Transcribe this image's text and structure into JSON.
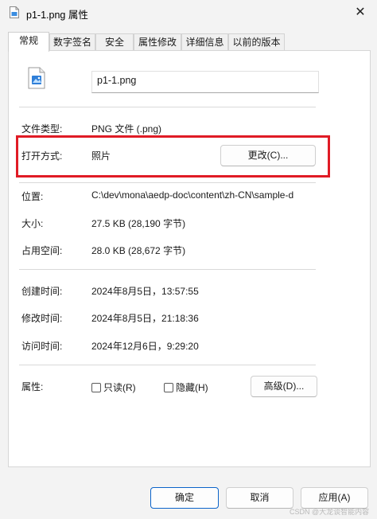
{
  "window": {
    "title": "p1-1.png 属性",
    "close_glyph": "✕"
  },
  "tabs": [
    {
      "label": "常规",
      "active": true
    },
    {
      "label": "数字签名"
    },
    {
      "label": "安全"
    },
    {
      "label": "属性修改"
    },
    {
      "label": "详细信息"
    },
    {
      "label": "以前的版本"
    }
  ],
  "general": {
    "file_name": "p1-1.png",
    "file_icon": "image-file-icon",
    "type_label": "文件类型:",
    "type_value": "PNG 文件 (.png)",
    "open_with_label": "打开方式:",
    "open_with_value": "照片",
    "change_button": "更改(C)...",
    "location_label": "位置:",
    "location_value": "C:\\dev\\mona\\aedp-doc\\content\\zh-CN\\sample-d",
    "size_label": "大小:",
    "size_value": "27.5 KB (28,190 字节)",
    "disk_size_label": "占用空间:",
    "disk_size_value": "28.0 KB (28,672 字节)",
    "created_label": "创建时间:",
    "created_value": "2024年8月5日，13:57:55",
    "modified_label": "修改时间:",
    "modified_value": "2024年8月5日，21:18:36",
    "accessed_label": "访问时间:",
    "accessed_value": "2024年12月6日，9:29:20",
    "attributes_label": "属性:",
    "readonly_label": "只读(R)",
    "readonly_checked": false,
    "hidden_label": "隐藏(H)",
    "hidden_checked": false,
    "advanced_button": "高级(D)..."
  },
  "footer": {
    "ok": "确定",
    "cancel": "取消",
    "apply": "应用(A)"
  },
  "watermark": "CSDN @大龙谈智能内容",
  "colors": {
    "highlight": "#e01b25",
    "primary_border": "#0a63c9"
  }
}
